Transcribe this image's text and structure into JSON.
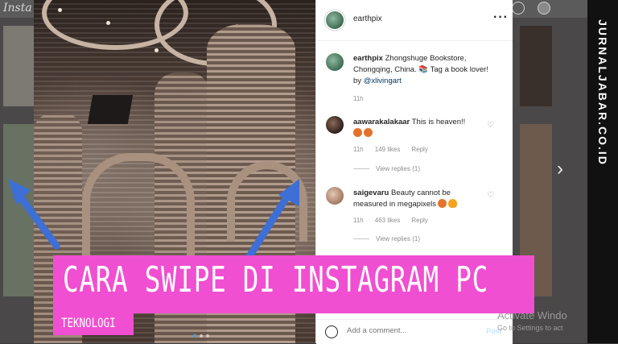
{
  "app": {
    "logo_text": "Insta"
  },
  "watermark": "JURNALJABAR.CO.ID",
  "post": {
    "username": "earthpix",
    "caption_text": "Zhongshuge Bookstore, Chongqing, China. 📚 Tag a book lover! by ",
    "caption_mention": "@xlivingart",
    "caption_time": "11h"
  },
  "comments": [
    {
      "username": "aawarakalakaar",
      "text": "This is heaven!!",
      "time": "11h",
      "likes": "149 likes",
      "reply_label": "Reply",
      "view_replies": "View replies (1)"
    },
    {
      "username": "saigevaru",
      "text": "Beauty cannot be measured in megapixels",
      "time": "11h",
      "likes": "463 likes",
      "reply_label": "Reply",
      "view_replies": "View replies (1)"
    }
  ],
  "comment_box": {
    "placeholder": "Add a comment...",
    "post_label": "Post"
  },
  "windows_notice": {
    "title": "Activate Windo",
    "subtitle": "Go to Settings to act"
  },
  "banner": {
    "title": "CARA SWIPE DI INSTAGRAM PC",
    "category": "TEKNOLOGI"
  },
  "colors": {
    "banner_pink": "#f04fd1",
    "arrow_blue": "#3d6fd6",
    "mention_blue": "#00376b"
  },
  "icons": {
    "more": "more-horizontal-icon",
    "heart": "heart-outline-icon",
    "smile": "emoji-smile-icon",
    "next": "chevron-right-icon"
  }
}
